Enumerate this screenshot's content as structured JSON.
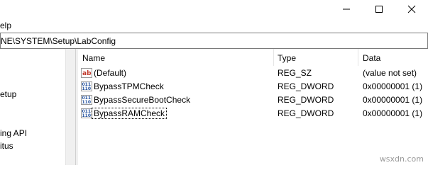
{
  "window": {
    "minimize_icon": "minimize-icon",
    "maximize_icon": "maximize-icon",
    "close_icon": "close-icon"
  },
  "menu": {
    "help": "elp"
  },
  "address": {
    "path": "NE\\SYSTEM\\Setup\\LabConfig"
  },
  "tree": {
    "items": [
      "etup",
      "ing API",
      "itus"
    ]
  },
  "list": {
    "headers": {
      "name": "Name",
      "type": "Type",
      "data": "Data"
    },
    "rows": [
      {
        "icon": "string-value-icon",
        "name": "(Default)",
        "type": "REG_SZ",
        "data": "(value not set)"
      },
      {
        "icon": "dword-value-icon",
        "name": "BypassTPMCheck",
        "type": "REG_DWORD",
        "data": "0x00000001 (1)"
      },
      {
        "icon": "dword-value-icon",
        "name": "BypassSecureBootCheck",
        "type": "REG_DWORD",
        "data": "0x00000001 (1)"
      },
      {
        "icon": "dword-value-icon",
        "name": "BypassRAMCheck",
        "type": "REG_DWORD",
        "data": "0x00000001 (1)"
      }
    ]
  },
  "watermark": "wsxdn.com",
  "colors": {
    "string_icon": "#c0392b",
    "dword_icon": "#1f4e9c"
  }
}
